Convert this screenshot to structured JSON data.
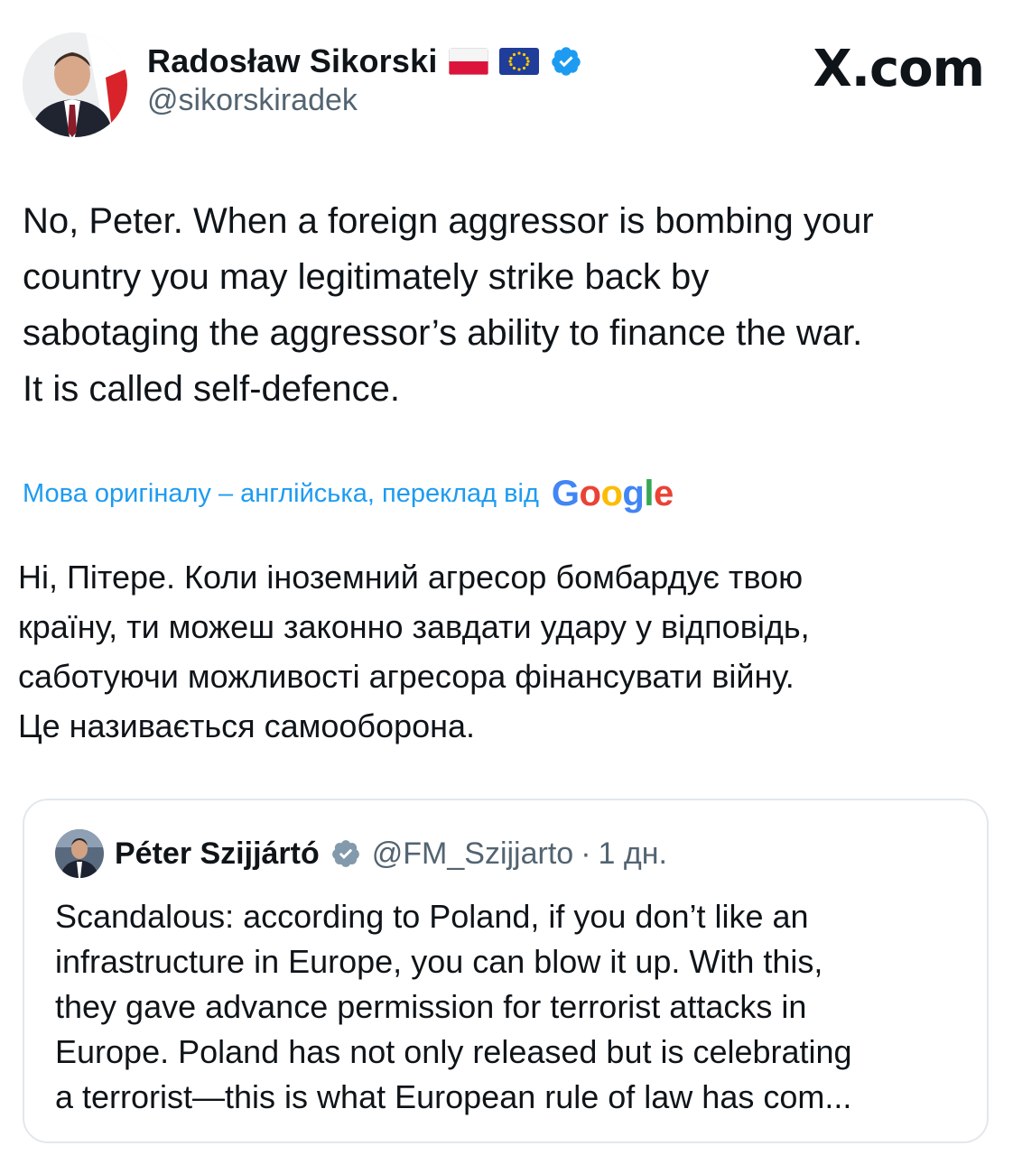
{
  "brand": "X.com",
  "author": {
    "display_name": "Radosław Sikorski",
    "handle": "@sikorskiradek",
    "flags": [
      "poland-flag-icon",
      "eu-flag-icon"
    ],
    "verified_icon": "verified-badge-icon"
  },
  "tweet": {
    "lines": [
      "No, Peter. When a foreign aggressor is bombing your",
      "country you may legitimately strike back by",
      "sabotaging the aggressor’s ability to finance the war.",
      "It is called self-defence."
    ]
  },
  "translation": {
    "note": "Мова оригіналу – англійська, переклад від",
    "provider": "Google",
    "lines": [
      "Ні, Пітере. Коли іноземний агресор бомбардує твою",
      "країну, ти можеш законно завдати удару у відповідь,",
      "саботуючи можливості агресора фінансувати війну.",
      "Це називається самооборона."
    ]
  },
  "quoted": {
    "display_name": "Péter Szijjártó",
    "handle": "@FM_Szijjarto",
    "separator": "·",
    "time": "1 дн.",
    "verified_icon": "verified-badge-gray-icon",
    "lines": [
      "Scandalous: according to Poland, if you don’t like an",
      "infrastructure in Europe, you can blow it up. With this,",
      "they gave advance permission for terrorist attacks in",
      "Europe. Poland has not only released but is celebrating",
      "a terrorist—this is what European rule of law has com..."
    ]
  },
  "colors": {
    "link_blue": "#1d9bf0",
    "secondary_text": "#536471",
    "border": "#e1e8ed",
    "verified_blue": "#1d9bf0"
  }
}
